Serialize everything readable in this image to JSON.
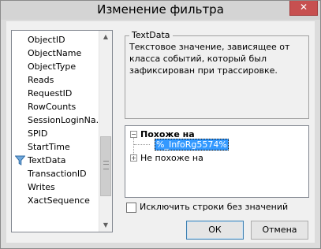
{
  "window": {
    "title": "Изменение фильтра",
    "close_label": "✕"
  },
  "event_columns": {
    "items": [
      "ObjectID",
      "ObjectName",
      "ObjectType",
      "Reads",
      "RequestID",
      "RowCounts",
      "SessionLoginNa...",
      "SPID",
      "StartTime",
      "TextData",
      "TransactionID",
      "Writes",
      "XactSequence"
    ],
    "selected": "TextData"
  },
  "description": {
    "title": "TextData",
    "text": "Текстовое значение, зависящее от класса событий, который был зафиксирован при трассировке."
  },
  "filter_tree": {
    "like_label": "Похоже на",
    "like_value": "%_InfoRg5574%",
    "not_like_label": "Не похоже на"
  },
  "exclude_empty": {
    "label": "Исключить строки без значений",
    "checked": false
  },
  "buttons": {
    "ok": "ОК",
    "cancel": "Отмена"
  }
}
